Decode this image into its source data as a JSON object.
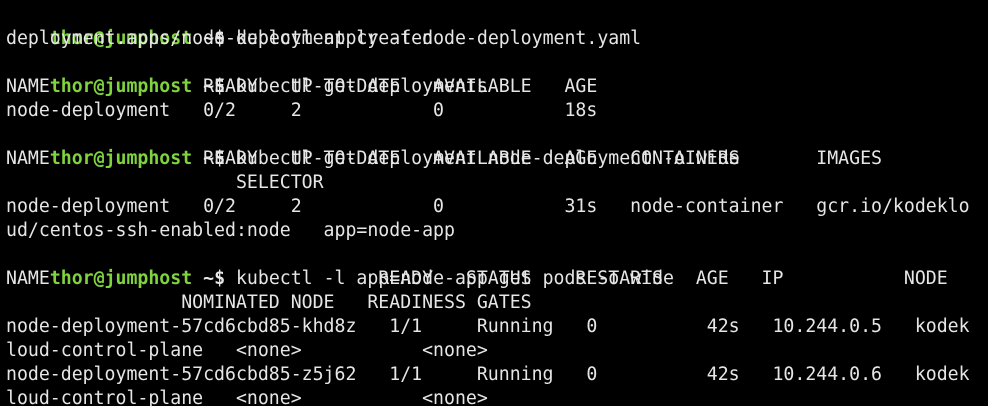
{
  "colors": {
    "background": "#000000",
    "prompt_user": "#7fd33e",
    "text": "#e6e6e6"
  },
  "prompt": {
    "user_host": "thor@jumphost",
    "symbol": " ~$ "
  },
  "lines": [
    {
      "type": "cmd",
      "text": "kubectl apply -f node-deployment.yaml"
    },
    {
      "type": "out",
      "text": "deployment.apps/node-deployment created"
    },
    {
      "type": "cmd",
      "text": "kubectl get deployments"
    },
    {
      "type": "out",
      "text": "NAME              READY   UP-TO-DATE   AVAILABLE   AGE"
    },
    {
      "type": "out",
      "text": "node-deployment   0/2     2            0           18s"
    },
    {
      "type": "cmd",
      "text": "kubectl get deployment node-deployment -o wide"
    },
    {
      "type": "out",
      "text": "NAME              READY   UP-TO-DATE   AVAILABLE   AGE   CONTAINERS       IMAGES"
    },
    {
      "type": "out",
      "text": "                     SELECTOR"
    },
    {
      "type": "out",
      "text": "node-deployment   0/2     2            0           31s   node-container   gcr.io/kodeklo"
    },
    {
      "type": "out",
      "text": "ud/centos-ssh-enabled:node   app=node-app"
    },
    {
      "type": "cmd",
      "text": "kubectl -l app=node-app get pods -o wide"
    },
    {
      "type": "out",
      "text": "NAME                              READY   STATUS    RESTARTS   AGE   IP           NODE"
    },
    {
      "type": "out",
      "text": "                NOMINATED NODE   READINESS GATES"
    },
    {
      "type": "out",
      "text": "node-deployment-57cd6cbd85-khd8z   1/1     Running   0          42s   10.244.0.5   kodek"
    },
    {
      "type": "out",
      "text": "loud-control-plane   <none>           <none>"
    },
    {
      "type": "out",
      "text": "node-deployment-57cd6cbd85-z5j62   1/1     Running   0          42s   10.244.0.6   kodek"
    },
    {
      "type": "out",
      "text": "loud-control-plane   <none>           <none>"
    }
  ]
}
